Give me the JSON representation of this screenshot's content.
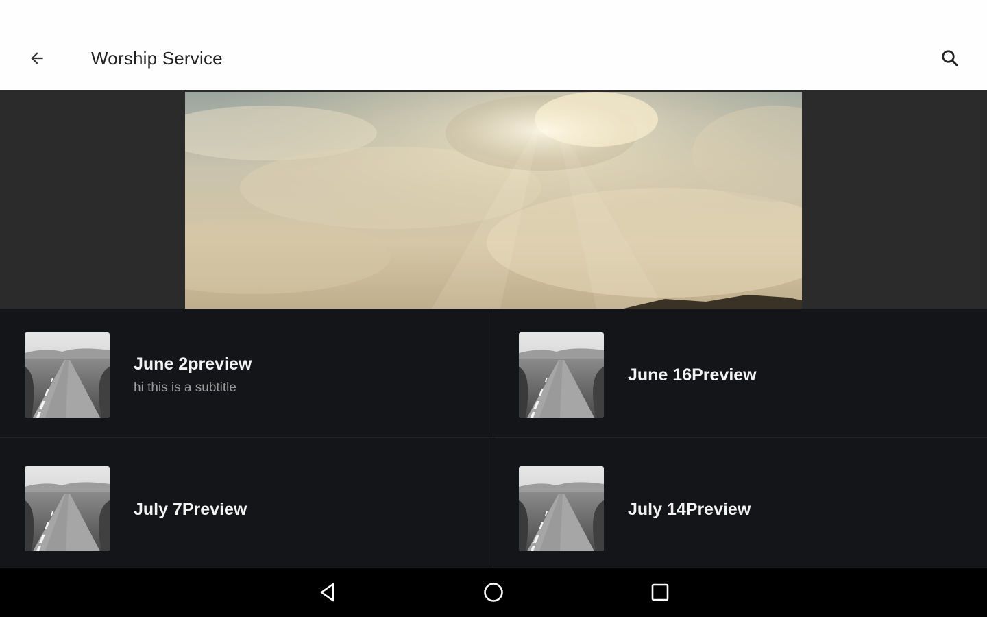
{
  "app_bar": {
    "title": "Worship Service",
    "back_icon": "arrow-back-icon",
    "search_icon": "search-icon",
    "background": "#fefefe"
  },
  "hero": {
    "image": "sky-clouds-sunrays-banner",
    "band_color": "#2b2b2b"
  },
  "items": [
    {
      "title": "June 2preview",
      "subtitle": "hi this is a subtitle",
      "thumbnail": "road-landscape-thumbnail"
    },
    {
      "title": "June 16Preview",
      "subtitle": "",
      "thumbnail": "road-landscape-thumbnail"
    },
    {
      "title": "July 7Preview",
      "subtitle": "",
      "thumbnail": "road-landscape-thumbnail"
    },
    {
      "title": "July 14Preview",
      "subtitle": "",
      "thumbnail": "road-landscape-thumbnail"
    }
  ],
  "nav_bar": {
    "back": "nav-back-icon",
    "home": "nav-home-icon",
    "recents": "nav-recents-icon"
  },
  "colors": {
    "grid_bg": "#141518",
    "title_text": "#f3f3f3",
    "subtitle_text": "#9c9c9c"
  }
}
